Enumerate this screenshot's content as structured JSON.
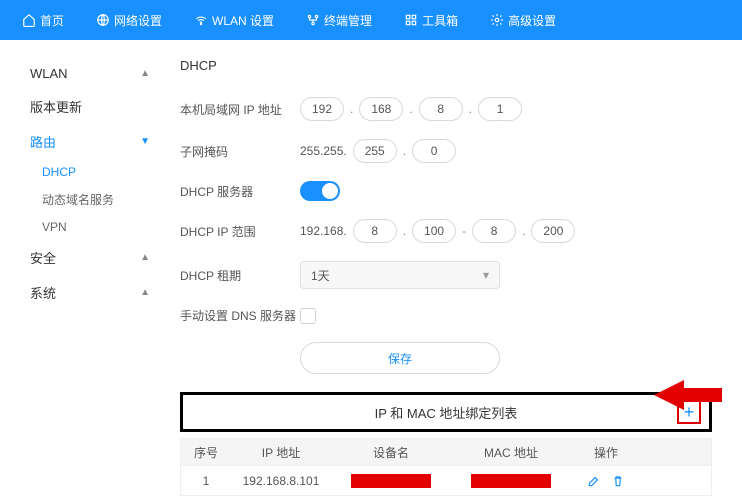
{
  "nav": {
    "home": "首页",
    "network": "网络设置",
    "wlan": "WLAN 设置",
    "terminal": "终端管理",
    "toolbox": "工具箱",
    "advanced": "高级设置"
  },
  "sidebar": {
    "wlan": "WLAN",
    "version": "版本更新",
    "routing": "路由",
    "dhcp": "DHCP",
    "ddns": "动态域名服务",
    "vpn": "VPN",
    "security": "安全",
    "system": "系统"
  },
  "dhcp": {
    "title": "DHCP",
    "lan_ip_label": "本机局域网 IP 地址",
    "lan_ip": [
      "192",
      "168",
      "8",
      "1"
    ],
    "subnet_label": "子网掩码",
    "subnet_prefix": "255.255.",
    "subnet": [
      "255",
      "0"
    ],
    "server_label": "DHCP 服务器",
    "range_label": "DHCP IP 范围",
    "range_prefix": "192.168.",
    "range": [
      "8",
      "100",
      "8",
      "200"
    ],
    "lease_label": "DHCP 租期",
    "lease_value": "1天",
    "manual_dns_label": "手动设置 DNS 服务器",
    "save": "保存"
  },
  "table": {
    "title": "IP 和 MAC 地址绑定列表",
    "headers": {
      "seq": "序号",
      "ip": "IP 地址",
      "device": "设备名",
      "mac": "MAC 地址",
      "ops": "操作"
    },
    "rows": [
      {
        "seq": "1",
        "ip": "192.168.8.101"
      }
    ]
  }
}
